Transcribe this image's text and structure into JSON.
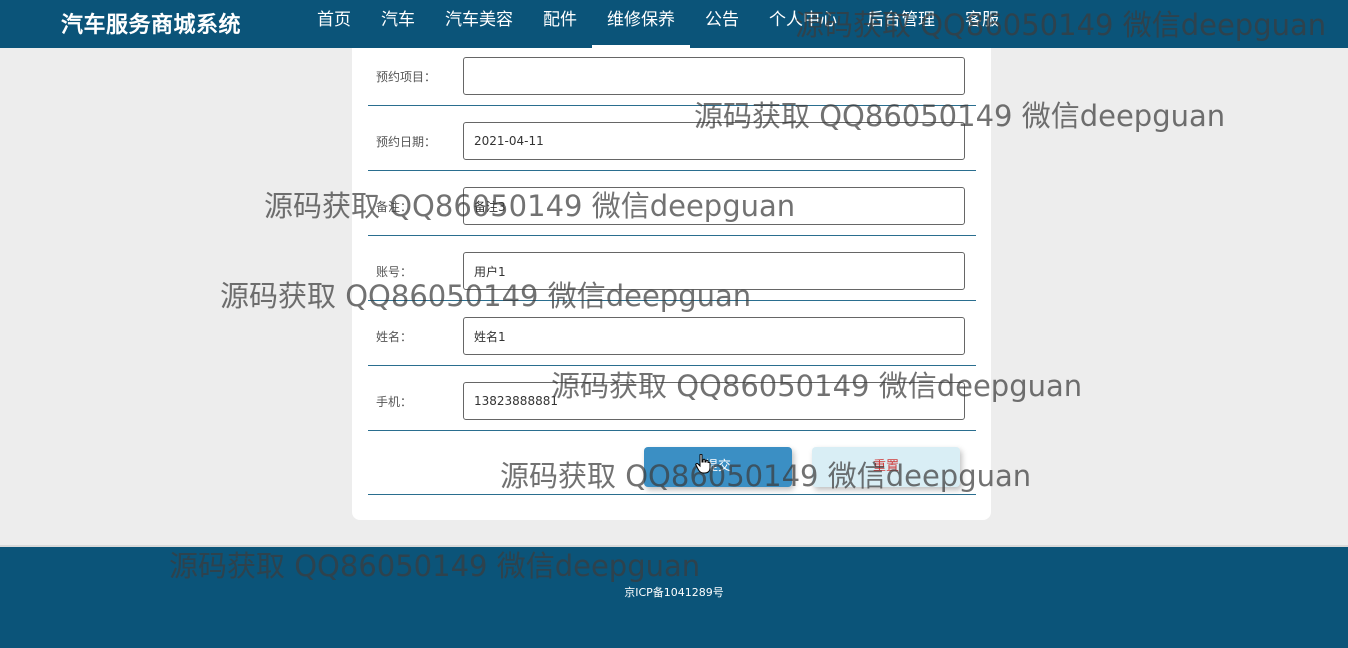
{
  "header": {
    "brand": "汽车服务商城系统",
    "nav": [
      {
        "label": "首页"
      },
      {
        "label": "汽车"
      },
      {
        "label": "汽车美容"
      },
      {
        "label": "配件"
      },
      {
        "label": "维修保养",
        "active": true
      },
      {
        "label": "公告"
      },
      {
        "label": "个人中心"
      },
      {
        "label": "后台管理"
      },
      {
        "label": "客服"
      }
    ]
  },
  "form": {
    "fields": [
      {
        "label": "预约项目：",
        "value": ""
      },
      {
        "label": "预约日期：",
        "value": "2021-04-11"
      },
      {
        "label": "备注：",
        "value": "备注3"
      },
      {
        "label": "账号：",
        "value": "用户1"
      },
      {
        "label": "姓名：",
        "value": "姓名1"
      },
      {
        "label": "手机：",
        "value": "13823888881"
      }
    ],
    "submit_label": "提交",
    "reset_label": "重置"
  },
  "footer": {
    "text": "京ICP备1041289号"
  },
  "watermark": "源码获取 QQ86050149 微信deepguan",
  "colors": {
    "header_bg": "#0b5479",
    "submit_bg": "#3b8fc4",
    "reset_bg": "#d9eef5",
    "reset_text": "#d03c3c",
    "page_bg": "#ededed"
  }
}
